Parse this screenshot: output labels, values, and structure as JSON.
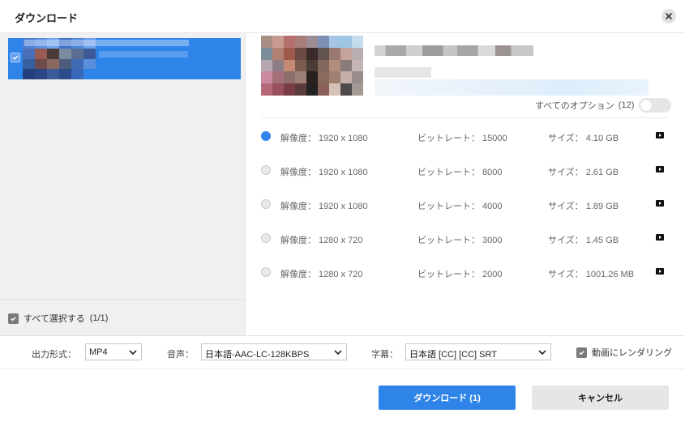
{
  "dialog": {
    "title": "ダウンロード",
    "close_icon": "close-icon"
  },
  "video_list": {
    "items": [
      {
        "selected": true,
        "thumbnail": "pixelated-thumbnail",
        "title_text": ""
      }
    ],
    "select_all": {
      "label": "すべて選択する",
      "count": "(1/1)",
      "checked": true
    }
  },
  "details": {
    "thumbnail": "pixelated-thumbnail",
    "all_options": {
      "label": "すべてのオプション",
      "count": "(12)",
      "enabled": false
    }
  },
  "options": [
    {
      "resolution": "解像度： 1920 x 1080",
      "bitrate": "ビットレート： 15000",
      "size": "サイズ： 4.10 GB",
      "selected": true,
      "icon": "play-icon"
    },
    {
      "resolution": "解像度： 1920 x 1080",
      "bitrate": "ビットレート： 8000",
      "size": "サイズ： 2.61 GB",
      "selected": false,
      "icon": "play-icon"
    },
    {
      "resolution": "解像度： 1920 x 1080",
      "bitrate": "ビットレート： 4000",
      "size": "サイズ： 1.89 GB",
      "selected": false,
      "icon": "play-icon"
    },
    {
      "resolution": "解像度： 1280 x 720",
      "bitrate": "ビットレート： 3000",
      "size": "サイズ： 1.45 GB",
      "selected": false,
      "icon": "play-icon"
    },
    {
      "resolution": "解像度： 1280 x 720",
      "bitrate": "ビットレート： 2000",
      "size": "サイズ： 1001.26 MB",
      "selected": false,
      "icon": "play-icon"
    }
  ],
  "settings": {
    "format_label": "出力形式：",
    "format_value": "MP4",
    "audio_label": "音声：",
    "audio_value": "日本語-AAC-LC-128KBPS",
    "subtitle_label": "字幕：",
    "subtitle_value": "日本語 [CC] [CC] SRT",
    "render_label": "動画にレンダリング",
    "render_checked": true
  },
  "buttons": {
    "download": "ダウンロード (1)",
    "cancel": "キャンセル"
  },
  "colors": {
    "accent": "#2f84ea",
    "panel_bg": "#f0f0f0"
  }
}
